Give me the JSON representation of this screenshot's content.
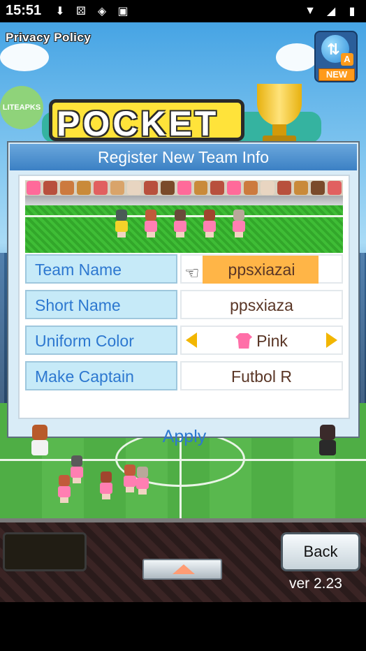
{
  "status_bar": {
    "time": "15:51",
    "left_icons": [
      "download-icon",
      "dice-icon",
      "shield-icon",
      "a-box-icon"
    ],
    "right_icons": [
      "wifi-icon",
      "signal-icon",
      "battery-icon"
    ]
  },
  "header": {
    "privacy_policy": "Privacy Policy",
    "new_badge": "NEW",
    "new_badge_letter": "A",
    "watermark": "LITEAPKS",
    "logo_text": "POCKET"
  },
  "dialog": {
    "title": "Register New Team Info",
    "rows": [
      {
        "label": "Team Name",
        "value": "ppsxiazai"
      },
      {
        "label": "Short Name",
        "value": "ppsxiaza"
      },
      {
        "label": "Uniform Color",
        "value": "Pink"
      },
      {
        "label": "Make Captain",
        "value": "Futbol R"
      }
    ],
    "apply_label": "Apply"
  },
  "bottom": {
    "back_label": "Back",
    "version": "ver 2.23"
  },
  "colors": {
    "title_bar": "#3b80c4",
    "label_bg": "#c6eaf8",
    "label_text": "#2d78d0",
    "highlight": "#ffb547",
    "uniform": "#ff6fa8"
  }
}
